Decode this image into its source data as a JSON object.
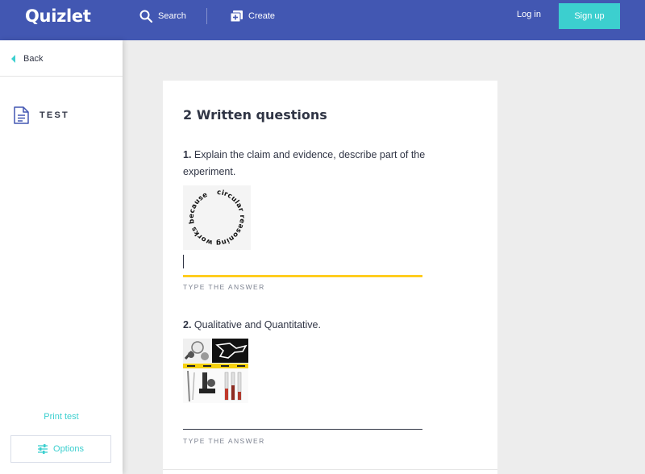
{
  "topbar": {
    "logo": "Quizlet",
    "search_label": "Search",
    "create_label": "Create",
    "login_label": "Log in",
    "signup_label": "Sign up",
    "colors": {
      "bar": "#4257b2",
      "accent": "#3ccfcf"
    }
  },
  "sidebar": {
    "back_label": "Back",
    "mode_label": "TEST",
    "print_label": "Print test",
    "options_label": "Options"
  },
  "test": {
    "section_title": "2 Written questions",
    "questions": [
      {
        "number": "1.",
        "prompt": "Explain the claim and evidence, describe part of the experiment.",
        "image_text": "circular reasoning works because",
        "answer_label": "TYPE THE ANSWER"
      },
      {
        "number": "2.",
        "prompt": "Qualitative and Quantitative.",
        "answer_label": "TYPE THE ANSWER"
      }
    ]
  },
  "icons": [
    "search-icon",
    "create-icon",
    "back-arrow-icon",
    "test-document-icon",
    "options-sliders-icon"
  ]
}
